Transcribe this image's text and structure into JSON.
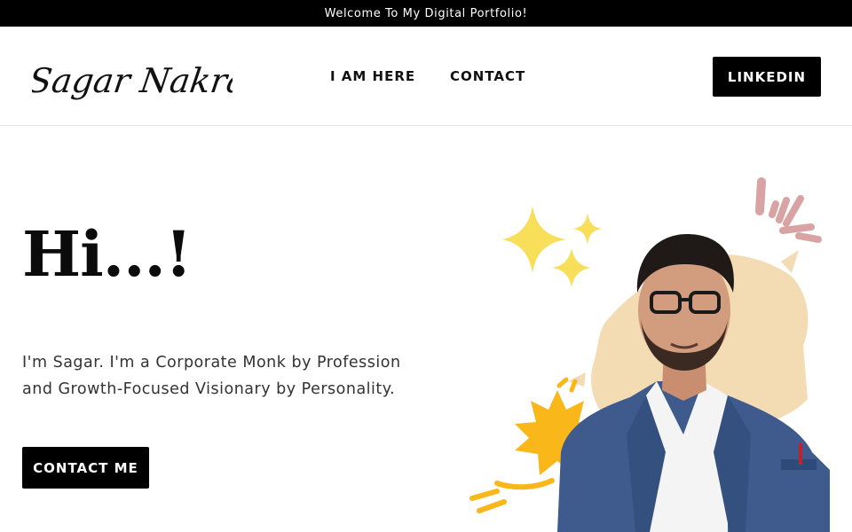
{
  "announcement": "Welcome To My Digital Portfolio!",
  "header": {
    "logo_text": "Sagar Nakrani",
    "nav": [
      {
        "label": "I AM HERE"
      },
      {
        "label": "CONTACT"
      }
    ],
    "cta_label": "LINKEDIN"
  },
  "hero": {
    "title": "Hi...!",
    "intro_line1": "I'm Sagar. I'm a Corporate Monk by Profession",
    "intro_line2": "and Growth-Focused Visionary by Personality.",
    "cta_label": "CONTACT ME"
  },
  "colors": {
    "announcement_bg": "#000000",
    "button_bg": "#000000",
    "sparkle": "#f7df5a",
    "burst": "#f9b71a",
    "paint_splash": "#f3dcb4",
    "accent_marks": "#d9a3a3",
    "blazer": "#3f5a8c"
  },
  "icons": [
    "sparkle-icon",
    "burst-icon",
    "accent-marks-icon"
  ]
}
